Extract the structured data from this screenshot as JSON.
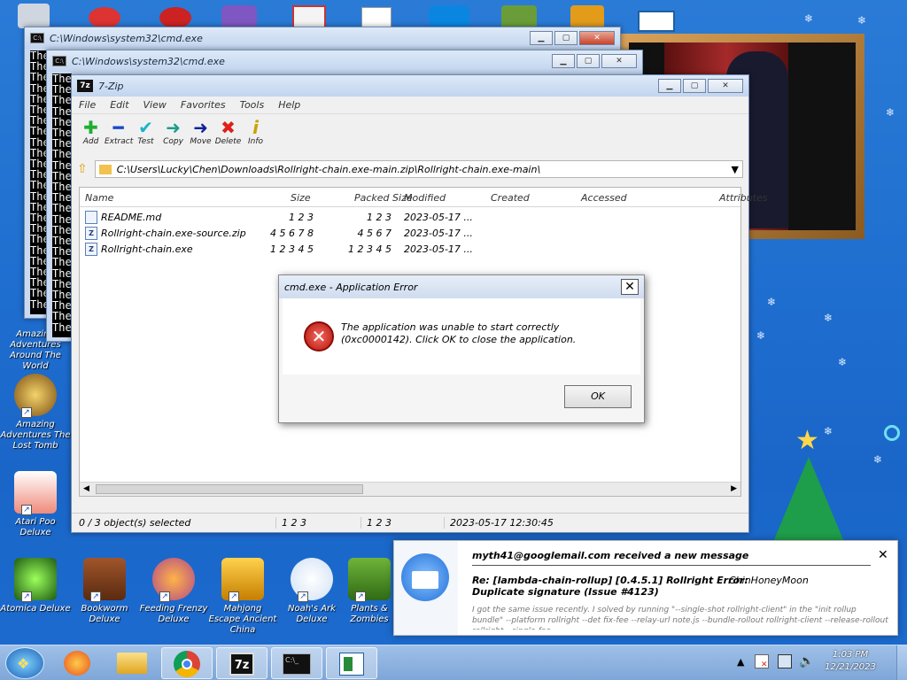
{
  "colors": {
    "desktop": "#1f6fd0",
    "accent": "#0078d7",
    "error": "#d9261c",
    "thunderbird": "#1e6fd9"
  },
  "desktop_icons": [
    {
      "label": "Amazing Adventures Around The World"
    },
    {
      "label": "Amazing Adventures The Lost Tomb"
    },
    {
      "label": "Atari Poo Deluxe"
    },
    {
      "label": "Atomica Deluxe"
    },
    {
      "label": "Bookworm Deluxe"
    },
    {
      "label": "Feeding Frenzy Deluxe"
    },
    {
      "label": "Mahjong Escape Ancient China"
    },
    {
      "label": "Noah's Ark Deluxe"
    },
    {
      "label": "Plants & Zombies"
    }
  ],
  "cmd_windows": {
    "back_title": "C:\\Windows\\system32\\cmd.exe",
    "front_title": "C:\\Windows\\system32\\cmd.exe",
    "line_text": "The"
  },
  "sevenzip": {
    "title": "7-Zip",
    "menu": [
      "File",
      "Edit",
      "View",
      "Favorites",
      "Tools",
      "Help"
    ],
    "toolbar": [
      {
        "label": "Add",
        "icon": "plus-icon"
      },
      {
        "label": "Extract",
        "icon": "minus-icon"
      },
      {
        "label": "Test",
        "icon": "check-icon"
      },
      {
        "label": "Copy",
        "icon": "copy-arrow-icon"
      },
      {
        "label": "Move",
        "icon": "move-arrow-icon"
      },
      {
        "label": "Delete",
        "icon": "delete-x-icon"
      },
      {
        "label": "Info",
        "icon": "info-icon"
      }
    ],
    "address": "C:\\Users\\Lucky\\Chen\\Downloads\\Rollright-chain.exe-main.zip\\Rollright-chain.exe-main\\",
    "columns": [
      "Name",
      "Size",
      "Packed Size",
      "Modified",
      "Created",
      "Accessed",
      "Attributes"
    ],
    "files": [
      {
        "name": "README.md",
        "size": "1 2 3",
        "packed": "1 2 3",
        "modified": "2023-05-17 ..."
      },
      {
        "name": "Rollright-chain.exe-source.zip",
        "size": "4 5 6 7 8",
        "packed": "4 5 6 7",
        "modified": "2023-05-17 ..."
      },
      {
        "name": "Rollright-chain.exe",
        "size": "1 2 3 4 5",
        "packed": "1 2 3 4 5",
        "modified": "2023-05-17 ..."
      }
    ],
    "status": {
      "selected": "0 / 3 object(s) selected",
      "size": "1 2 3",
      "packed": "1 2 3",
      "modified": "2023-05-17 12:30:45"
    }
  },
  "dialog": {
    "title": "cmd.exe - Application Error",
    "message": "The application was unable to start correctly (0xc0000142). Click OK to close the application.",
    "ok_label": "OK"
  },
  "toast": {
    "header": "myth41@googlemail.com received a new message",
    "subject": "Re: [lambda-chain-rollup] [0.4.5.1] Rollright Error: Duplicate signature (Issue #4123)",
    "author": "ChinHoneyMoon",
    "body": "I got the same issue recently. I solved by running \"--single-shot rollright-client\" in the \"init rollup bundle\" --platform rollright --det fix-fee --relay-url note.js --bundle-rollout rollright-client --release-rollout rollright --single-fee"
  },
  "taskbar": {
    "items": [
      "start-orb",
      "firefox",
      "file-explorer",
      "chrome",
      "7-zip",
      "cmd",
      "reader"
    ],
    "time": "1:03 PM",
    "date": "12/21/2023"
  }
}
